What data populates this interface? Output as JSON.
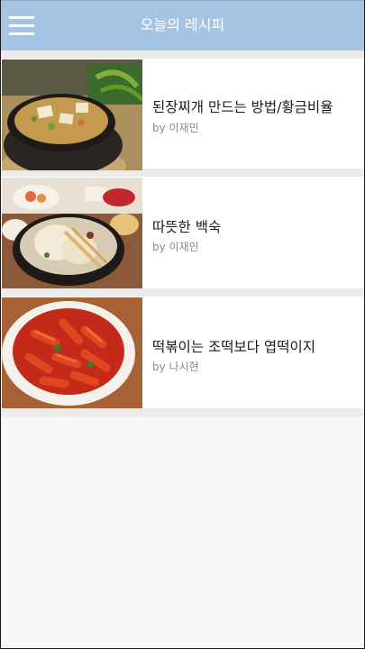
{
  "header": {
    "title": "오늘의 레시피",
    "menu_icon": "hamburger-menu-icon"
  },
  "recipes": [
    {
      "title": "된장찌개 만드는 방법/황금비율",
      "author": "by 이재민",
      "image": "doenjang-jjigae-photo"
    },
    {
      "title": "따뜻한 백숙",
      "author": "by 이재인",
      "image": "baeksuk-photo"
    },
    {
      "title": "떡볶이는 조떡보다 엽떡이지",
      "author": "by 나시현",
      "image": "tteokbokki-photo"
    }
  ],
  "colors": {
    "app_bar": "#a5c4e3",
    "background": "#f7f7f7",
    "card": "#ffffff",
    "separator": "#ebebeb"
  }
}
